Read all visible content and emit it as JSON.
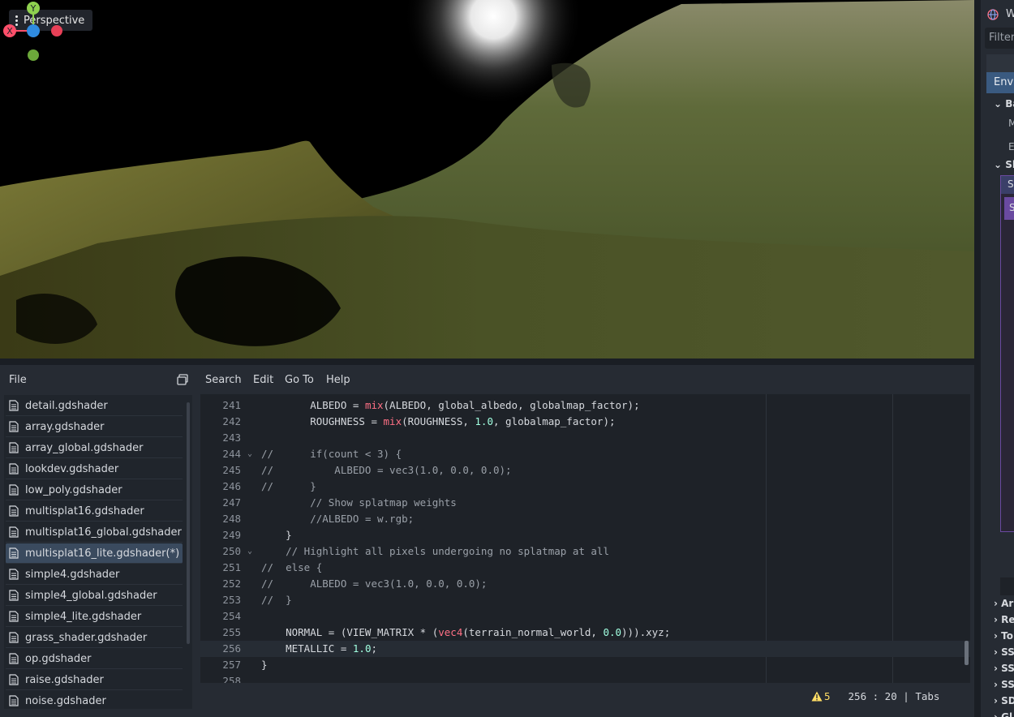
{
  "viewport": {
    "mode_label": "Perspective"
  },
  "gizmo": {
    "y": "Y",
    "x": "X"
  },
  "menu": {
    "file": "File",
    "search": "Search",
    "edit": "Edit",
    "goto": "Go To",
    "help": "Help"
  },
  "files": [
    "detail.gdshader",
    "array.gdshader",
    "array_global.gdshader",
    "lookdev.gdshader",
    "low_poly.gdshader",
    "multisplat16.gdshader",
    "multisplat16_global.gdshader",
    "multisplat16_lite.gdshader(*)",
    "simple4.gdshader",
    "simple4_global.gdshader",
    "simple4_lite.gdshader",
    "grass_shader.gdshader",
    "op.gdshader",
    "raise.gdshader",
    "noise.gdshader"
  ],
  "selected_file": "multisplat16_lite.gdshader(*)",
  "code_lines": [
    {
      "n": "241",
      "t": "        ALBEDO = mix(ALBEDO, global_albedo, globalmap_factor);"
    },
    {
      "n": "242",
      "t": "        ROUGHNESS = mix(ROUGHNESS, 1.0, globalmap_factor);"
    },
    {
      "n": "243",
      "t": ""
    },
    {
      "n": "244",
      "t": "//      if(count < 3) {"
    },
    {
      "n": "245",
      "t": "//          ALBEDO = vec3(1.0, 0.0, 0.0);"
    },
    {
      "n": "246",
      "t": "//      }"
    },
    {
      "n": "247",
      "t": "        // Show splatmap weights"
    },
    {
      "n": "248",
      "t": "        //ALBEDO = w.rgb;"
    },
    {
      "n": "249",
      "t": "    }"
    },
    {
      "n": "250",
      "t": "    // Highlight all pixels undergoing no splatmap at all"
    },
    {
      "n": "251",
      "t": "//  else {"
    },
    {
      "n": "252",
      "t": "//      ALBEDO = vec3(1.0, 0.0, 0.0);"
    },
    {
      "n": "253",
      "t": "//  }"
    },
    {
      "n": "254",
      "t": ""
    },
    {
      "n": "255",
      "t": "    NORMAL = (VIEW_MATRIX * (vec4(terrain_normal_world, 0.0))).xyz;"
    },
    {
      "n": "256",
      "t": "    METALLIC = 1.0;"
    },
    {
      "n": "257",
      "t": "}"
    },
    {
      "n": "258",
      "t": ""
    }
  ],
  "status": {
    "warnings": "5",
    "position": "256 :  20 | Tabs"
  },
  "inspector": {
    "tab": "W",
    "filter": "Filter",
    "section": "Env",
    "rows": [
      "Ba",
      "M",
      "E",
      "Sk",
      "S",
      "S"
    ],
    "collapsed": [
      "Ar",
      "Re",
      "To",
      "SS",
      "SS",
      "SS",
      "SD",
      "Gl"
    ]
  }
}
